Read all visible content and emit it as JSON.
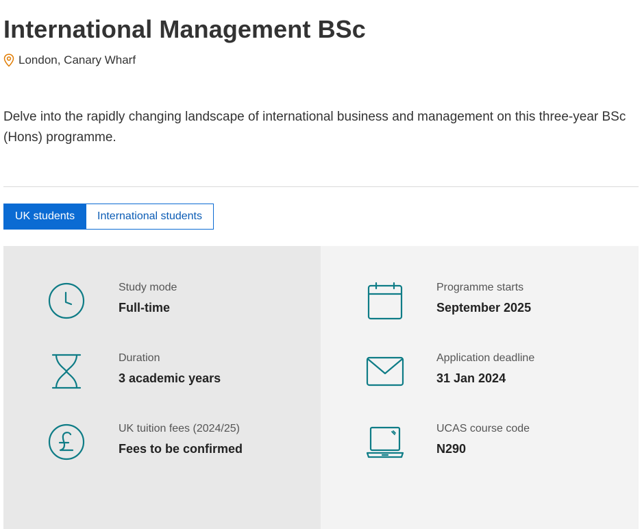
{
  "page": {
    "title": "International Management BSc",
    "location": "London, Canary Wharf",
    "description": "Delve into the rapidly changing landscape of international business and management on this three-year BSc (Hons) programme."
  },
  "tabs": [
    {
      "label": "UK students",
      "active": true
    },
    {
      "label": "International students",
      "active": false
    }
  ],
  "details": {
    "left": [
      {
        "label": "Study mode",
        "value": "Full-time",
        "icon": "clock-icon"
      },
      {
        "label": "Duration",
        "value": "3 academic years",
        "icon": "hourglass-icon"
      },
      {
        "label": "UK tuition fees (2024/25)",
        "value": "Fees to be confirmed",
        "icon": "pound-icon"
      }
    ],
    "right": [
      {
        "label": "Programme starts",
        "value": "September 2025",
        "icon": "calendar-icon"
      },
      {
        "label": "Application deadline",
        "value": "31 Jan 2024",
        "icon": "envelope-icon"
      },
      {
        "label": "UCAS course code",
        "value": "N290",
        "icon": "laptop-icon"
      }
    ]
  },
  "colors": {
    "accent_blue": "#0b6bd3",
    "icon_teal": "#0e7c86",
    "location_pin": "#e07b00",
    "panel_left_bg": "#e8e8e8",
    "panel_right_bg": "#f3f3f3"
  }
}
